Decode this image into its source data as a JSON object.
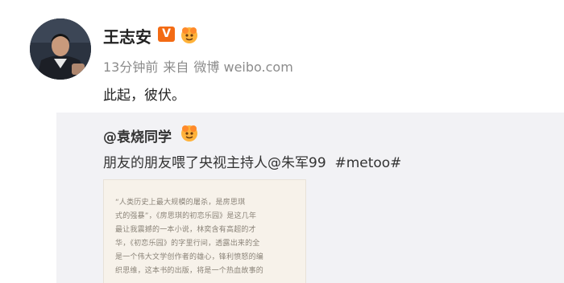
{
  "post": {
    "author": "王志安",
    "verified_badge": "V",
    "verified_color": "#f36b14",
    "vip_icon": "vip-member-icon",
    "time": "13分钟前",
    "source_prefix": "来自",
    "source_name": "微博 weibo.com",
    "text": "此起，彼伏。"
  },
  "repost": {
    "original_author": "@袁烧同学",
    "vip_icon": "vip-member-icon",
    "text_prefix": "朋友的朋友喂了央视主持人",
    "mention": "@朱军99",
    "hashtag": "#metoo#",
    "image": {
      "lines": [
        "“人类历史上最大规模的屠杀，是房思琪",
        "式的强暴”，《房思琪的初恋乐园》是这几年",
        "最让我震撼的一本小说，林奕含有高超的才",
        "华，《初恋乐园》的字里行间，透露出来的全",
        "是一个伟大文学创作者的雄心，锋利愤怒的编",
        "织思维，这本书的出版，将是一个热血故事的"
      ]
    }
  }
}
